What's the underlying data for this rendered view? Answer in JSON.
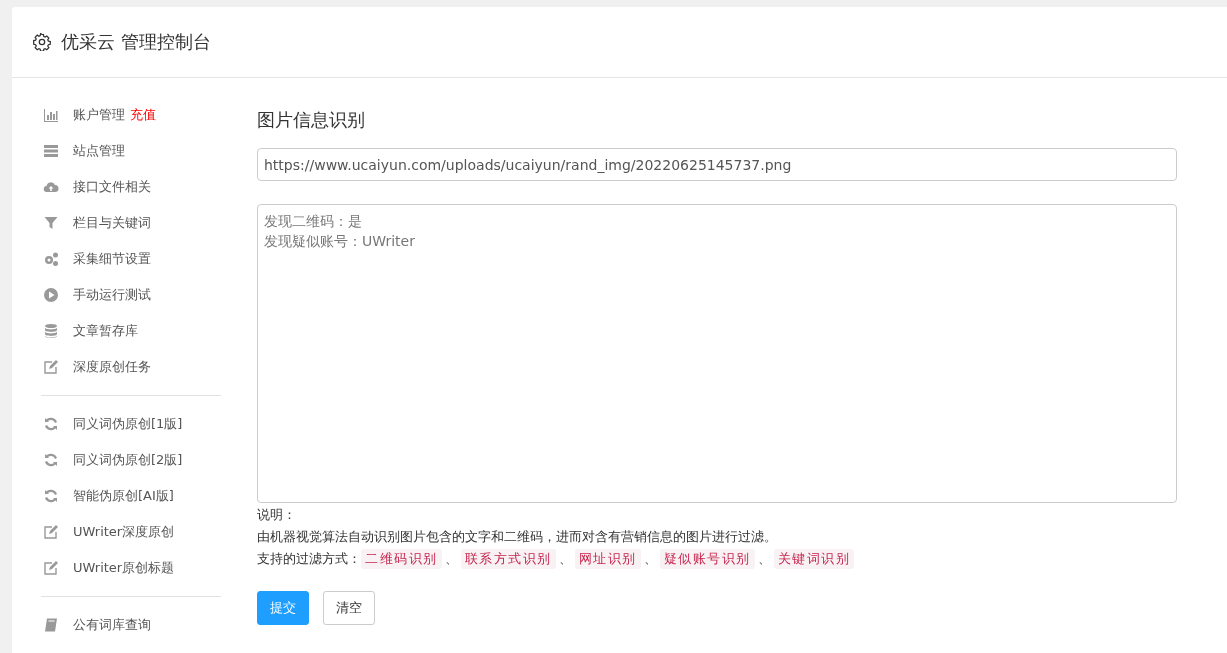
{
  "header": {
    "title": "优采云 管理控制台"
  },
  "sidebar": {
    "groups": [
      {
        "items": [
          {
            "label": "账户管理",
            "badge": "充值"
          },
          {
            "label": "站点管理"
          },
          {
            "label": "接口文件相关"
          },
          {
            "label": "栏目与关键词"
          },
          {
            "label": "采集细节设置"
          },
          {
            "label": "手动运行测试"
          },
          {
            "label": "文章暂存库"
          },
          {
            "label": "深度原创任务"
          }
        ]
      },
      {
        "items": [
          {
            "label": "同义词伪原创[1版]"
          },
          {
            "label": "同义词伪原创[2版]"
          },
          {
            "label": "智能伪原创[AI版]"
          },
          {
            "label": "UWriter深度原创"
          },
          {
            "label": "UWriter原创标题"
          }
        ]
      },
      {
        "items": [
          {
            "label": "公有词库查询"
          }
        ]
      }
    ]
  },
  "main": {
    "title": "图片信息识别",
    "url_field": {
      "value": "https://www.ucaiyun.com/uploads/ucaiyun/rand_img/20220625145737.png"
    },
    "result_lines": [
      "发现二维码：是",
      "发现疑似账号：UWriter"
    ],
    "note_label": "说明：",
    "note_text": "由机器视觉算法自动识别图片包含的文字和二维码，进而对含有营销信息的图片进行过滤。",
    "filters_label": "支持的过滤方式：",
    "filters": [
      {
        "label": "二维码识别",
        "separator": "、"
      },
      {
        "label": "联系方式识别",
        "separator": "、"
      },
      {
        "label": "网址识别",
        "separator": "、"
      },
      {
        "label": "疑似账号识别",
        "separator": "、"
      },
      {
        "label": "关键词识别"
      }
    ],
    "buttons": [
      {
        "label": "提交",
        "kind": "primary"
      },
      {
        "label": "清空",
        "kind": "default"
      }
    ]
  }
}
